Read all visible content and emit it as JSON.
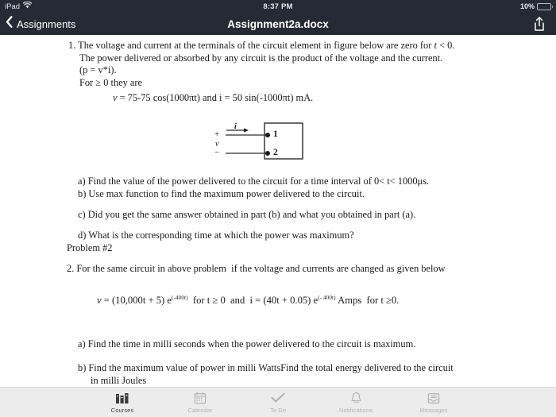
{
  "status_bar": {
    "device_label": "iPad",
    "wifi_icon": "wifi-icon",
    "time": "8:37 PM",
    "battery_percent": "10%",
    "battery_icon": "battery-low-icon",
    "battery_level": 10,
    "background_color": "#252a35"
  },
  "nav_bar": {
    "back_icon": "chevron-left-icon",
    "back_label": "Assignments",
    "title": "Assignment2a.docx",
    "share_icon": "share-icon",
    "background_color": "#252a35"
  },
  "document": {
    "problem1": {
      "number_line": "1. The voltage and current at the terminals of the circuit element in figure below are zero for ",
      "number_line_italic": "t",
      "number_line_tail": " < 0.",
      "line2": "The power delivered or absorbed by any circuit is the product of the voltage and the current.",
      "line3": "(p = v*i).",
      "line4": "For ≥ 0 they are",
      "equation_v": "v",
      "equation_rest": " = 75-75 cos(1000πt) and i = 50 sin(-1000πt) mA."
    },
    "figure": {
      "name": "circuit-element-figure",
      "current_label": "i",
      "plus_label": "+",
      "voltage_label": "v",
      "minus_label": "−",
      "terminal_1": "1",
      "terminal_2": "2"
    },
    "problem1_questions": [
      "a) Find the value of the power delivered to the circuit for a time interval of 0< t< 1000μs.",
      "b) Use max function to find the maximum power delivered to the circuit.",
      "c) Did you get the same answer obtained in part (b) and what you obtained in part (a).",
      "d) What is the corresponding time at which the power was maximum?"
    ],
    "problem2_heading": "Problem #2",
    "problem2_line": "2. For the same circuit in above problem  if the voltage and currents are changed as given below",
    "problem2_equation": {
      "v_symbol": "v",
      "part1": " = (10,000t + 5) e",
      "exp1": "(-400t)",
      "part2": "  for t ≥ 0  and  i = (40t + 0.05) e",
      "exp2": "(- 400t)",
      "part3": " Amps  for t ≥0."
    },
    "problem2_questions": [
      "a) Find the time in milli seconds when the power delivered to the circuit is maximum.",
      "b) Find the maximum value of power in milli WattsFind the total energy delivered to the circuit",
      "in milli Joules"
    ]
  },
  "tab_bar": {
    "background_color": "#ececec",
    "active_color": "#3b3b3b",
    "inactive_color": "#b2b2b2",
    "tabs": [
      {
        "label": "Courses",
        "icon": "courses-icon",
        "active": true
      },
      {
        "label": "Calendar",
        "icon": "calendar-icon",
        "active": false
      },
      {
        "label": "To Do",
        "icon": "checkmark-icon",
        "active": false
      },
      {
        "label": "Notifications",
        "icon": "bell-icon",
        "active": false
      },
      {
        "label": "Messages",
        "icon": "inbox-icon",
        "active": false
      }
    ]
  }
}
